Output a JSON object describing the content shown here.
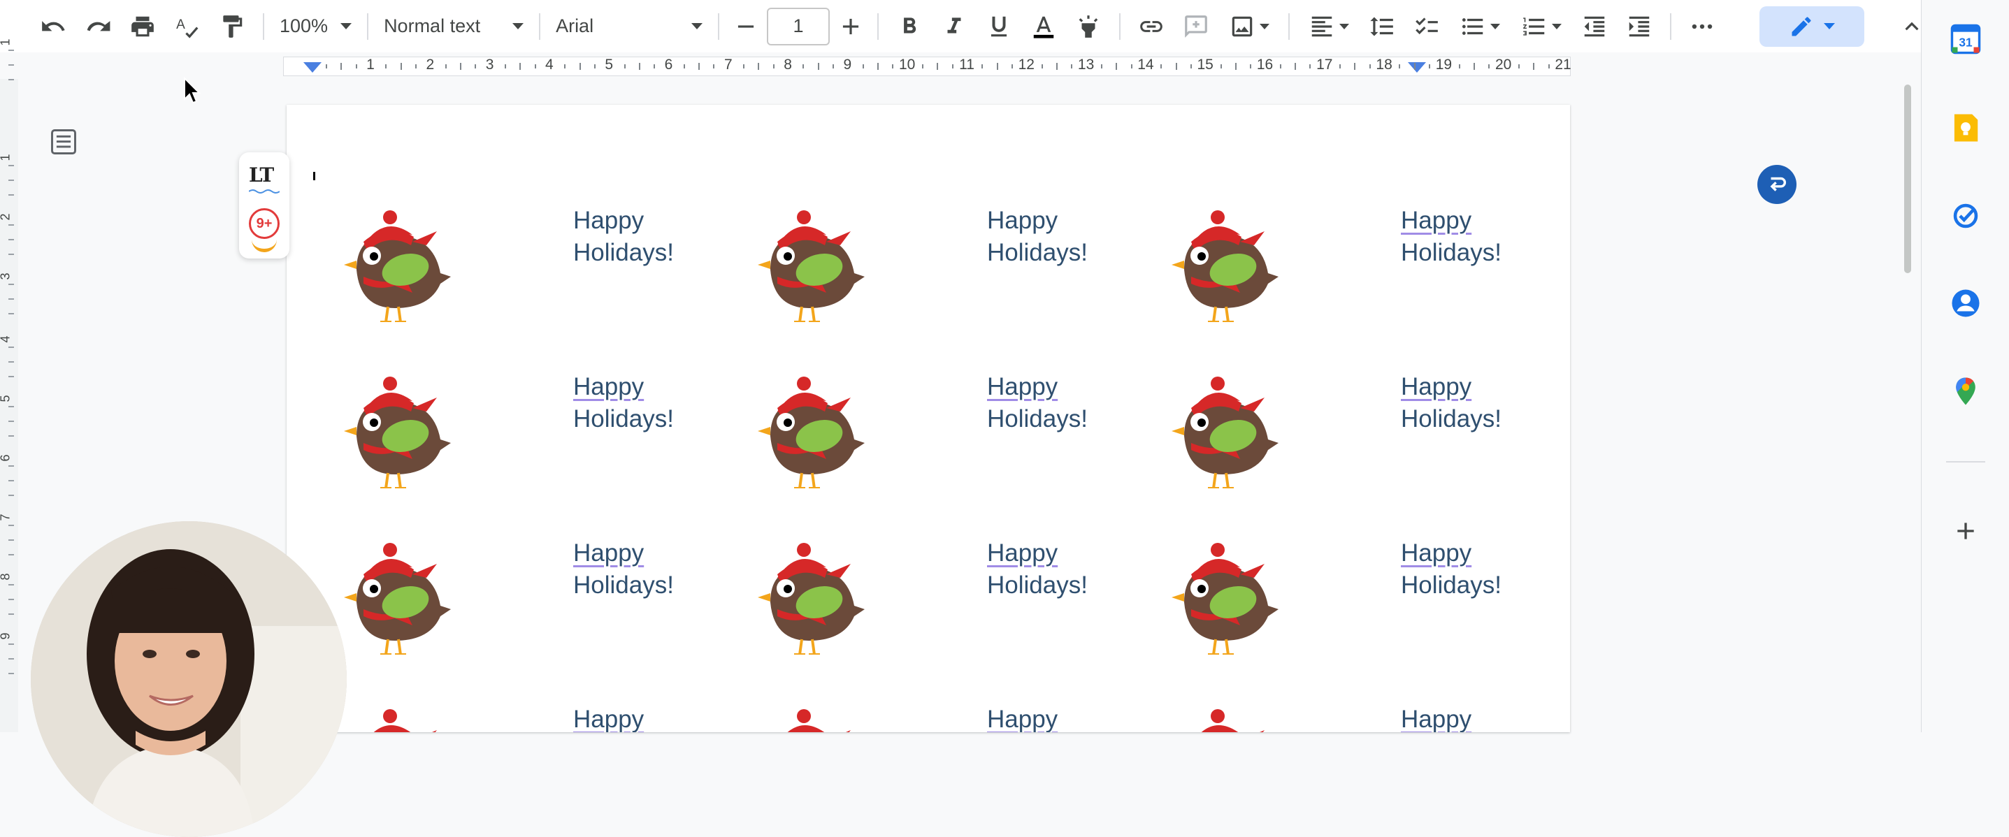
{
  "toolbar": {
    "zoom": "100%",
    "style": "Normal text",
    "font": "Arial",
    "font_size": "1"
  },
  "ruler": {
    "numbers": [
      "1",
      "2",
      "3",
      "4",
      "5",
      "6",
      "7",
      "8",
      "9",
      "10",
      "11",
      "12",
      "13",
      "14",
      "15",
      "16",
      "17",
      "18",
      "19",
      "20",
      "21"
    ],
    "vertical_numbers": [
      "1",
      "1",
      "2",
      "3",
      "4",
      "5",
      "6",
      "7",
      "8",
      "9"
    ]
  },
  "extension": {
    "logo_text": "LT",
    "badge_text": "9+"
  },
  "document": {
    "labels": [
      {
        "line1": "Happy",
        "line2": "Holidays!"
      },
      {
        "line1": "Happy",
        "line2": "Holidays!"
      },
      {
        "line1": "Happy",
        "line2": "Holidays!"
      },
      {
        "line1": "Happy",
        "line2": "Holidays!"
      },
      {
        "line1": "Happy",
        "line2": "Holidays!"
      },
      {
        "line1": "Happy",
        "line2": "Holidays!"
      },
      {
        "line1": "Happy",
        "line2": "Holidays!"
      },
      {
        "line1": "Happy",
        "line2": "Holidays!"
      },
      {
        "line1": "Happy",
        "line2": "Holidays!"
      },
      {
        "line1": "Happy",
        "line2": ""
      },
      {
        "line1": "Happy",
        "line2": ""
      },
      {
        "line1": "Happy",
        "line2": ""
      }
    ]
  },
  "side_panel": {
    "calendar_day": "31",
    "icons": [
      "calendar-icon",
      "keep-icon",
      "tasks-icon",
      "contacts-icon",
      "maps-icon",
      "add-icon"
    ]
  },
  "colors": {
    "accent": "#1a73e8",
    "label_text": "#2f4f6f",
    "bird_body": "#6b4a3a",
    "bird_hat": "#d62828",
    "bird_wing": "#8bc34a"
  }
}
